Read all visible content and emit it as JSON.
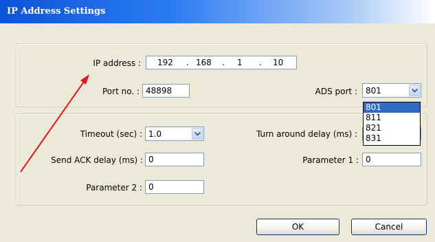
{
  "window": {
    "title": "IP Address Settings"
  },
  "ip_group": {
    "ip_label": "IP address :",
    "ip_octets": [
      "192",
      "168",
      "1",
      "10"
    ],
    "ip_separator": ".",
    "port_label": "Port no. :",
    "port_value": "48898",
    "ads_port_label": "ADS port :",
    "ads_port_value": "801",
    "ads_port_options": [
      "801",
      "811",
      "821",
      "831"
    ],
    "ads_port_highlighted": "801"
  },
  "comm_group": {
    "timeout_label": "Timeout (sec) :",
    "timeout_value": "1.0",
    "turnaround_label": "Turn around delay (ms) :",
    "send_ack_label": "Send ACK delay (ms) :",
    "send_ack_value": "0",
    "param1_label": "Parameter 1 :",
    "param1_value": "0",
    "param2_label": "Parameter 2 :",
    "param2_value": "0"
  },
  "buttons": {
    "ok": "OK",
    "cancel": "Cancel"
  },
  "annotation": {
    "arrow_color": "#e8141c"
  },
  "colors": {
    "title_bar": "#0a54d8",
    "selection": "#316ac5",
    "field_border": "#7f9db9"
  }
}
